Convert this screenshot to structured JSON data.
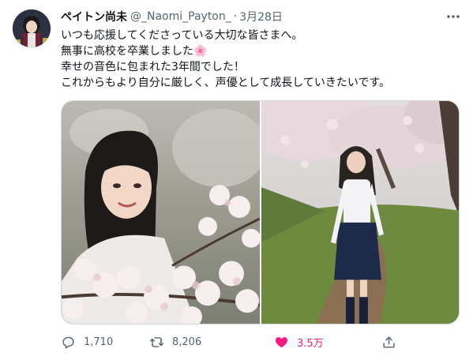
{
  "tweet": {
    "author_name": "ペイトン尚未",
    "handle": "@_Naomi_Payton_",
    "separator": "·",
    "date": "3月28日",
    "lines": [
      "いつも応援してくださっている大切な皆さまへ。",
      "無事に高校を卒業しました🌸",
      "幸せの音色に包まれた3年間でした！",
      "これからもより自分に厳しく、声優として成長していきたいです。"
    ]
  },
  "stats": {
    "replies": "1,710",
    "retweets": "8,206",
    "likes": "3.5万"
  },
  "colors": {
    "like_active": "#f91880",
    "secondary_text": "#536471",
    "border": "#cfd9de"
  },
  "icons": {
    "more": "more-icon",
    "reply": "reply-icon",
    "retweet": "retweet-icon",
    "like": "heart-filled-icon",
    "share": "share-icon"
  }
}
